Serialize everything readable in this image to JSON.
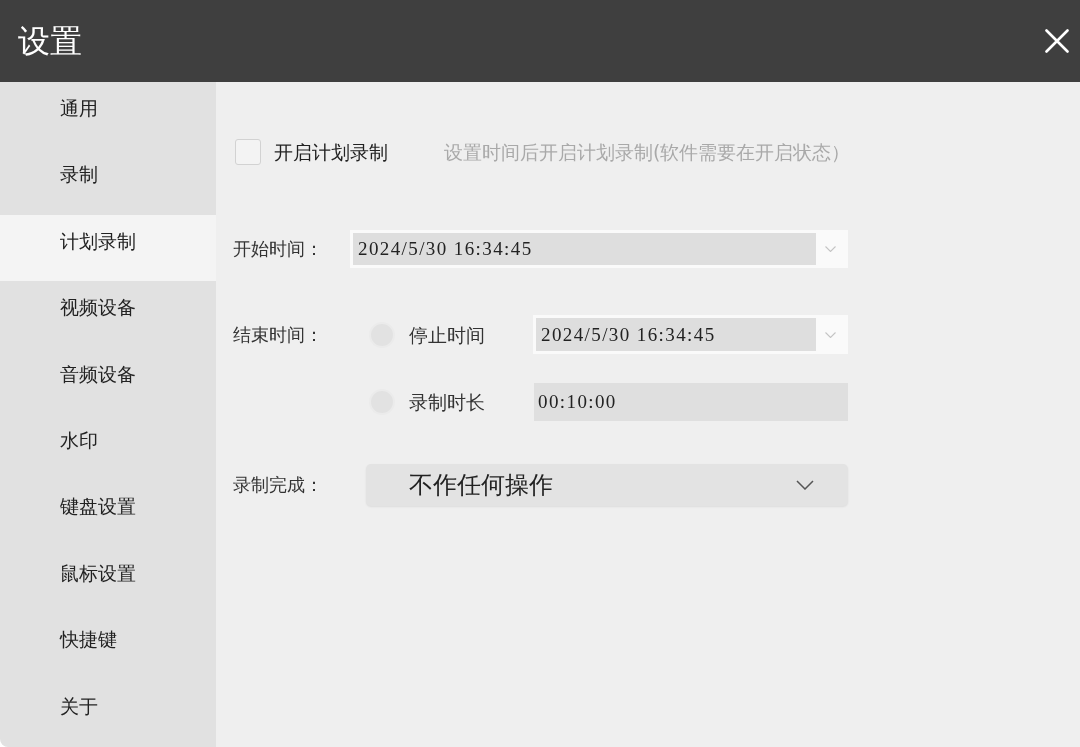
{
  "window": {
    "title": "设置"
  },
  "sidebar": {
    "items": [
      {
        "label": "通用",
        "selected": false
      },
      {
        "label": "录制",
        "selected": false
      },
      {
        "label": "计划录制",
        "selected": true
      },
      {
        "label": "视频设备",
        "selected": false
      },
      {
        "label": "音频设备",
        "selected": false
      },
      {
        "label": "水印",
        "selected": false
      },
      {
        "label": "键盘设置",
        "selected": false
      },
      {
        "label": "鼠标设置",
        "selected": false
      },
      {
        "label": "快捷键",
        "selected": false
      },
      {
        "label": "关于",
        "selected": false
      }
    ]
  },
  "schedule": {
    "enable": {
      "label": "开启计划录制",
      "checked": false
    },
    "hint": "设置时间后开启计划录制(软件需要在开启状态）"
  },
  "start_time": {
    "label": "开始时间：",
    "value": "2024/5/30 16:34:45"
  },
  "end_time": {
    "label": "结束时间：",
    "options": [
      {
        "kind": "datetime",
        "label": "停止时间",
        "selected": false,
        "value": "2024/5/30 16:34:45"
      },
      {
        "kind": "duration",
        "label": "录制时长",
        "selected": false,
        "value": "00:10:00"
      }
    ]
  },
  "on_finish": {
    "label": "录制完成：",
    "value": "不作任何操作"
  }
}
